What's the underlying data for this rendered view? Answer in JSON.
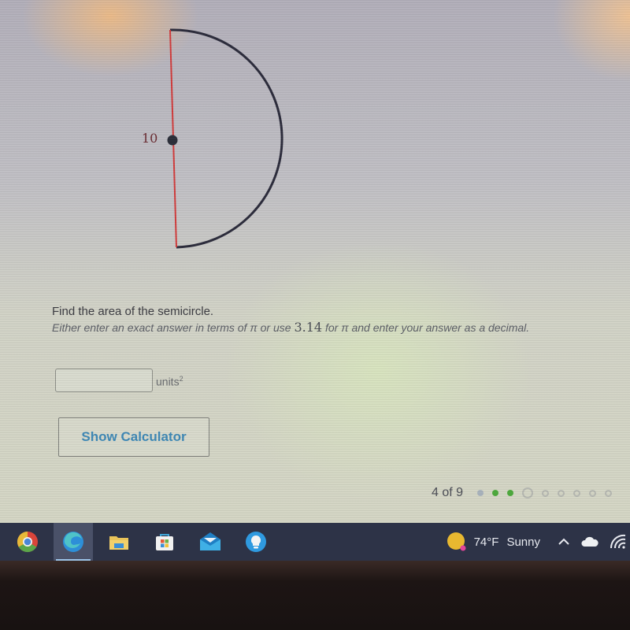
{
  "figure": {
    "label": "10",
    "shape": "semicircle",
    "diameter_color": "#d23a3a",
    "arc_color": "#2a2a3a"
  },
  "question": {
    "title": "Find the area of the semicircle.",
    "instr_part1": "Either enter an exact answer in terms of ",
    "pi": "π",
    "instr_part2": " or use ",
    "pi_value": "3.14",
    "instr_part3": " for ",
    "instr_part4": " and enter your answer as a decimal."
  },
  "answer": {
    "value": "",
    "placeholder": "",
    "units_label": "units",
    "units_exponent": "2"
  },
  "buttons": {
    "show_calculator": "Show Calculator"
  },
  "progress": {
    "text": "4 of 9",
    "current": 4,
    "total": 9,
    "dots": [
      {
        "state": "complete-gray",
        "color": "#a9b3bd"
      },
      {
        "state": "correct",
        "color": "#4caa3c"
      },
      {
        "state": "correct",
        "color": "#4caa3c"
      },
      {
        "state": "current",
        "color": "#b6b8b2"
      },
      {
        "state": "upcoming",
        "color": "#b6b8b2"
      },
      {
        "state": "upcoming",
        "color": "#b6b8b2"
      },
      {
        "state": "upcoming",
        "color": "#b6b8b2"
      },
      {
        "state": "upcoming",
        "color": "#b6b8b2"
      },
      {
        "state": "upcoming",
        "color": "#b6b8b2"
      }
    ]
  },
  "taskbar": {
    "apps": [
      {
        "name": "chrome-icon",
        "active": false
      },
      {
        "name": "edge-icon",
        "active": true
      },
      {
        "name": "file-explorer-icon",
        "active": false
      },
      {
        "name": "microsoft-store-icon",
        "active": false
      },
      {
        "name": "mail-icon",
        "active": false
      },
      {
        "name": "tips-icon",
        "active": false
      }
    ],
    "weather": {
      "temperature": "74°F",
      "condition": "Sunny"
    },
    "tray_icons": [
      "chevron-up-icon",
      "onedrive-cloud-icon",
      "wifi-icon"
    ]
  }
}
